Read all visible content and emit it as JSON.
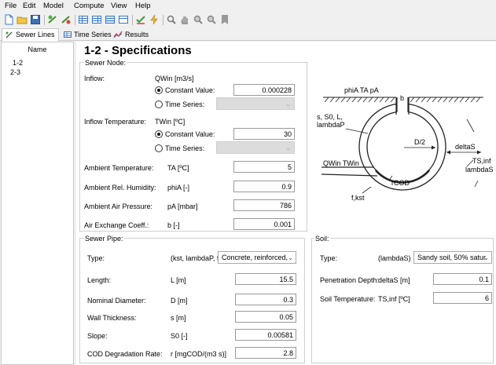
{
  "menu": {
    "file": "File",
    "edit": "Edit",
    "model": "Model",
    "compute": "Compute",
    "view": "View",
    "help": "Help"
  },
  "tabs": {
    "sewer_lines": "Sewer Lines",
    "time_series": "Time Series",
    "results": "Results"
  },
  "tree": {
    "header": "Name",
    "items": [
      "1-2",
      "2-3"
    ],
    "selected": "1-2"
  },
  "page_title": "1-2 - Specifications",
  "sewer_node": {
    "legend": "Sewer Node:",
    "inflow": {
      "label": "Inflow:",
      "symbol": "QWin [m3/s]",
      "constant_label": "Constant Value:",
      "constant_value": "0.000228",
      "timeseries_label": "Time Series:",
      "selected": "constant"
    },
    "inflow_temp": {
      "label": "Inflow Temperature:",
      "symbol": "TWin [ºC]",
      "constant_label": "Constant Value:",
      "constant_value": "30",
      "timeseries_label": "Time Series:",
      "selected": "constant"
    },
    "ambient_temp": {
      "label": "Ambient Temperature:",
      "symbol": "TA [ºC]",
      "value": "5"
    },
    "humidity": {
      "label": "Ambient Rel. Humidity:",
      "symbol": "phiA [-]",
      "value": "0.9"
    },
    "pressure": {
      "label": "Ambient Air Pressure:",
      "symbol": "pA [mbar]",
      "value": "786"
    },
    "air_exchange": {
      "label": "Air Exchange Coeff.:",
      "symbol": "b [-]",
      "value": "0.001"
    }
  },
  "diagram": {
    "top_label": "phiA TA pA",
    "b": "b",
    "pipe_params": [
      "s, S0, L,",
      "lambdaP"
    ],
    "d2": "D/2",
    "deltaS": "deltaS",
    "ts_inf": [
      "TS,inf",
      "lambdaS"
    ],
    "inflow": "QWin TWin",
    "rcod": "rCOD",
    "fkst": "f,kst"
  },
  "sewer_pipe": {
    "legend": "Sewer Pipe:",
    "type": {
      "label": "Type:",
      "symbol": "(kst, lambdaP, f)",
      "value": "Concrete, reinforced,"
    },
    "length": {
      "label": "Length:",
      "symbol": "L [m]",
      "value": "15.5"
    },
    "diameter": {
      "label": "Nominal Diameter:",
      "symbol": "D [m]",
      "value": "0.3"
    },
    "wall": {
      "label": "Wall Thickness:",
      "symbol": "s [m]",
      "value": "0.05"
    },
    "slope": {
      "label": "Slope:",
      "symbol": "S0 [-]",
      "value": "0.00581"
    },
    "cod": {
      "label": "COD Degradation Rate:",
      "symbol": "r [mgCOD/(m3 s)]",
      "value": "2.8"
    }
  },
  "soil": {
    "legend": "Soil:",
    "type": {
      "label": "Type:",
      "symbol": "(lambdaS)",
      "value": "Sandy soil, 50% satur"
    },
    "penetration": {
      "label": "Penetration Depth:",
      "symbol": "deltaS [m]",
      "value": "0.1"
    },
    "temperature": {
      "label": "Soil Temperature:",
      "symbol": "TS,inf [ºC]",
      "value": "6"
    }
  }
}
